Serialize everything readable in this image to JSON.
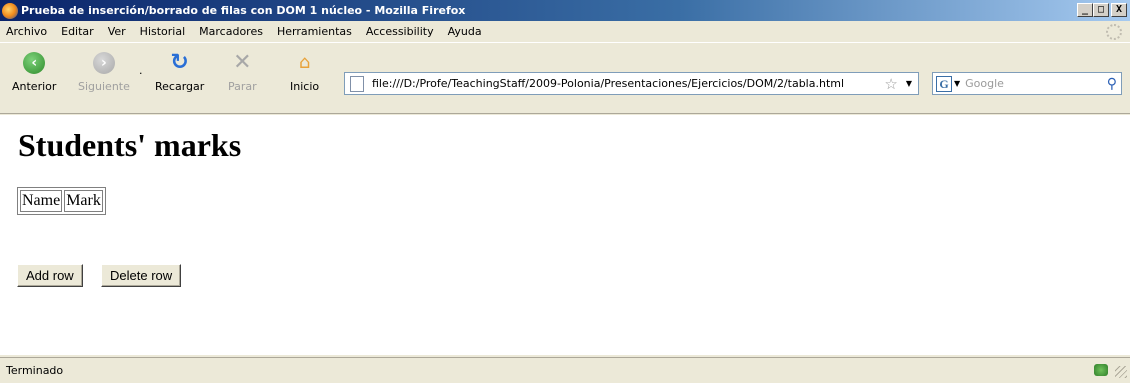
{
  "window": {
    "title": "Prueba de inserción/borrado de filas con DOM 1 núcleo - Mozilla Firefox",
    "minimize": "_",
    "maximize": "□",
    "close": "X"
  },
  "menu": [
    "Archivo",
    "Editar",
    "Ver",
    "Historial",
    "Marcadores",
    "Herramientas",
    "Accessibility",
    "Ayuda"
  ],
  "nav": {
    "back": "Anterior",
    "forward": "Siguiente",
    "reload": "Recargar",
    "stop": "Parar",
    "home": "Inicio",
    "dropdown_marker": "."
  },
  "url": "file:///D:/Profe/TeachingStaff/2009-Polonia/Presentaciones/Ejercicios/DOM/2/tabla.html",
  "search": {
    "engine_letter": "G",
    "placeholder": "Google"
  },
  "page": {
    "heading": "Students' marks",
    "table_headers": [
      "Name",
      "Mark"
    ],
    "buttons": {
      "add": "Add row",
      "delete": "Delete row"
    }
  },
  "status": "Terminado",
  "icons": {
    "back": "back-arrow-icon",
    "forward": "forward-arrow-icon",
    "reload": "reload-icon",
    "stop": "stop-icon",
    "home": "home-icon",
    "bookmark": "bookmark-star-icon",
    "search": "magnifier-icon"
  }
}
